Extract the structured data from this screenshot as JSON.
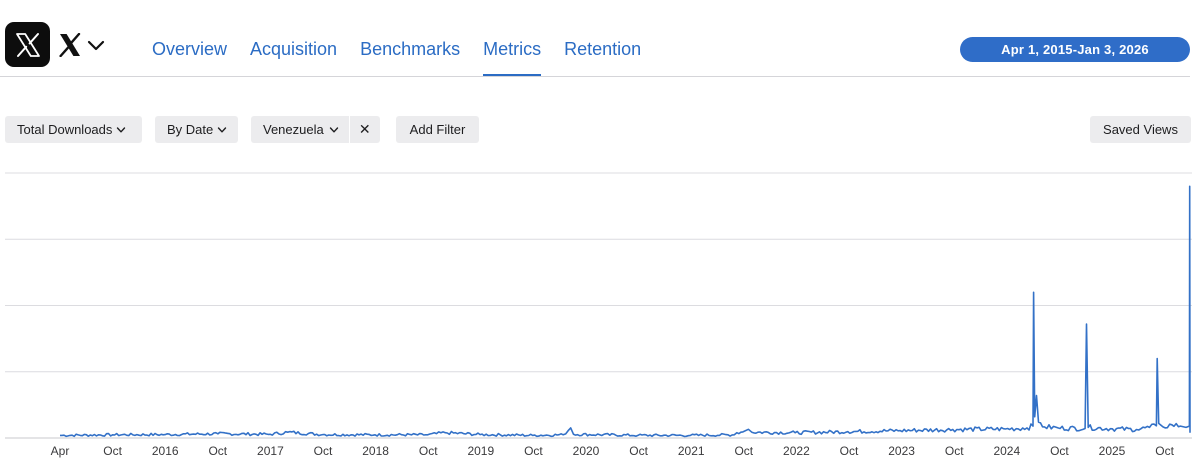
{
  "app": {
    "icon": "x-logo-icon",
    "name_icon": "x-wordmark-icon",
    "dropdown_icon": "chevron-down-icon"
  },
  "tabs": [
    {
      "label": "Overview",
      "active": false
    },
    {
      "label": "Acquisition",
      "active": false
    },
    {
      "label": "Benchmarks",
      "active": false
    },
    {
      "label": "Metrics",
      "active": true
    },
    {
      "label": "Retention",
      "active": false
    }
  ],
  "date_range": "Apr 1, 2015-Jan 3, 2026",
  "filters": {
    "metric": "Total Downloads",
    "breakdown": "By Date",
    "country": "Venezuela",
    "remove_symbol": "✕",
    "add_filter": "Add Filter",
    "saved_views": "Saved Views"
  },
  "colors": {
    "accent": "#2b6cc4",
    "pill": "#2f6dc8",
    "series": "#3371c7"
  },
  "chart_data": {
    "type": "line",
    "x_tick_labels": [
      "Apr",
      "Oct",
      "2016",
      "Oct",
      "2017",
      "Oct",
      "2018",
      "Oct",
      "2019",
      "Oct",
      "2020",
      "Oct",
      "2021",
      "Oct",
      "2022",
      "Oct",
      "2023",
      "Oct",
      "2024",
      "Oct",
      "2025",
      "Oct"
    ],
    "x_range": [
      "2015-04-01",
      "2026-01-03"
    ],
    "y_axis_labels": "none",
    "ylim": [
      0,
      100
    ],
    "gridlines": 4,
    "series": [
      {
        "points": [
          [
            "2015-04-01",
            1.0
          ],
          [
            "2015-10-01",
            1.2
          ],
          [
            "2016-04-01",
            1.3
          ],
          [
            "2016-10-01",
            1.6
          ],
          [
            "2017-04-01",
            1.4
          ],
          [
            "2017-06-01",
            2.2
          ],
          [
            "2017-10-01",
            1.3
          ],
          [
            "2018-04-01",
            1.2
          ],
          [
            "2018-10-01",
            1.2
          ],
          [
            "2018-12-01",
            2.0
          ],
          [
            "2019-04-01",
            1.3
          ],
          [
            "2019-10-01",
            1.0
          ],
          [
            "2020-01-15",
            1.2
          ],
          [
            "2020-02-10",
            3.8
          ],
          [
            "2020-02-20",
            1.4
          ],
          [
            "2020-10-01",
            1.0
          ],
          [
            "2021-04-01",
            1.0
          ],
          [
            "2021-09-01",
            1.2
          ],
          [
            "2021-09-10",
            2.0
          ],
          [
            "2021-10-01",
            2.3
          ],
          [
            "2021-10-20",
            3.3
          ],
          [
            "2021-11-01",
            2.2
          ],
          [
            "2022-04-01",
            2.0
          ],
          [
            "2022-10-01",
            2.4
          ],
          [
            "2023-04-01",
            2.8
          ],
          [
            "2023-10-01",
            3.2
          ],
          [
            "2024-04-01",
            3.4
          ],
          [
            "2024-06-15",
            3.8
          ],
          [
            "2024-07-06",
            4.5
          ],
          [
            "2024-07-08",
            55.0
          ],
          [
            "2024-07-12",
            8.0
          ],
          [
            "2024-07-18",
            16.0
          ],
          [
            "2024-07-25",
            6.0
          ],
          [
            "2024-08-15",
            4.2
          ],
          [
            "2024-10-01",
            3.8
          ],
          [
            "2025-01-03",
            3.6
          ],
          [
            "2025-01-08",
            43.0
          ],
          [
            "2025-01-14",
            4.0
          ],
          [
            "2025-04-01",
            3.5
          ],
          [
            "2025-07-01",
            3.2
          ],
          [
            "2025-08-15",
            4.0
          ],
          [
            "2025-09-08",
            4.6
          ],
          [
            "2025-09-11",
            30.0
          ],
          [
            "2025-09-16",
            5.5
          ],
          [
            "2025-10-01",
            4.2
          ],
          [
            "2025-11-01",
            5.0
          ],
          [
            "2025-12-01",
            4.5
          ],
          [
            "2025-12-20",
            4.0
          ],
          [
            "2026-01-01",
            4.5
          ],
          [
            "2026-01-02",
            95.0
          ],
          [
            "2026-01-03",
            2.0
          ]
        ]
      }
    ]
  }
}
